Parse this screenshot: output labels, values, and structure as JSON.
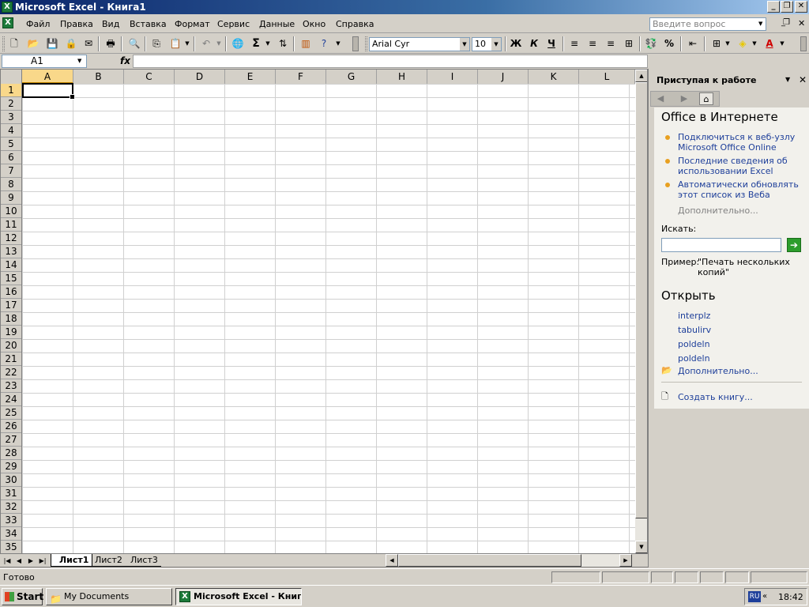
{
  "window": {
    "title": "Microsoft Excel - Книга1",
    "app_icon": "excel-icon"
  },
  "menu": {
    "items": [
      "Файл",
      "Правка",
      "Вид",
      "Вставка",
      "Формат",
      "Сервис",
      "Данные",
      "Окно",
      "Справка"
    ],
    "help_placeholder": "Введите вопрос"
  },
  "toolbar": {
    "font": "Arial Cyr",
    "size": "10",
    "bold": "Ж",
    "italic": "К",
    "underline": "Ч",
    "sigma": "Σ",
    "percent": "%"
  },
  "formula_bar": {
    "name_box": "A1",
    "fx": "fx",
    "value": ""
  },
  "grid": {
    "columns": [
      "A",
      "B",
      "C",
      "D",
      "E",
      "F",
      "G",
      "H",
      "I",
      "J",
      "K",
      "L"
    ],
    "rows": [
      "1",
      "2",
      "3",
      "4",
      "5",
      "6",
      "7",
      "8",
      "9",
      "10",
      "11",
      "12",
      "13",
      "14",
      "15",
      "16",
      "17",
      "18",
      "19",
      "20",
      "21",
      "22",
      "23",
      "24",
      "25",
      "26",
      "27",
      "28",
      "29",
      "30",
      "31",
      "32",
      "33",
      "34",
      "35"
    ],
    "active_cell": "A1"
  },
  "sheets": {
    "tabs": [
      "Лист1",
      "Лист2",
      "Лист3"
    ],
    "active": "Лист1"
  },
  "task_pane": {
    "title": "Приступая к работе",
    "online": {
      "heading": "Office в Интернете",
      "links": [
        "Подключиться к веб-узлу Microsoft Office Online",
        "Последние сведения об использовании Excel",
        "Автоматически обновлять этот список из Веба"
      ],
      "more": "Дополнительно..."
    },
    "search": {
      "label": "Искать:",
      "example_label": "Пример:",
      "example": "\"Печать нескольких копий\""
    },
    "open": {
      "heading": "Открыть",
      "files": [
        "interplz",
        "tabulirv",
        "poldeln",
        "poldeln"
      ],
      "more": "Дополнительно...",
      "create": "Создать книгу..."
    }
  },
  "status": {
    "text": "Готово"
  },
  "taskbar": {
    "start": "Start",
    "items": [
      "My Documents",
      "Microsoft Excel - Книг..."
    ],
    "lang": "RU",
    "clock": "18:42"
  }
}
